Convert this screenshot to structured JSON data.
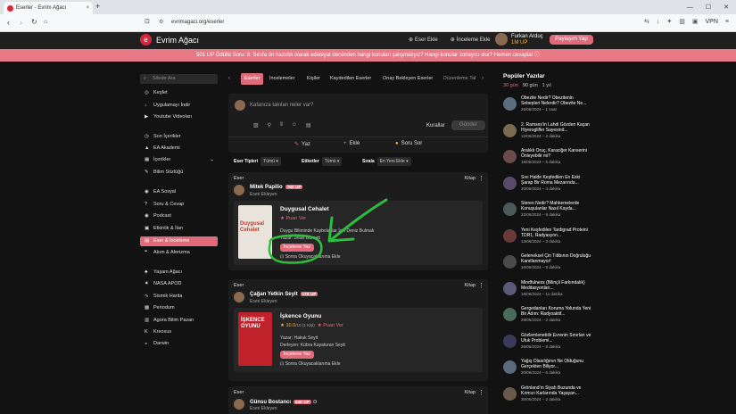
{
  "browser": {
    "tab_title": "Eserler - Evrim Ağacı",
    "tab_close": "×",
    "new_tab": "+",
    "url": "evrimagaci.org/eserler",
    "vpn_label": "VPN",
    "window_controls": [
      "—",
      "☐",
      "✕"
    ]
  },
  "site": {
    "name": "Evrim Ağacı",
    "add_work": "Eser Ekle",
    "add_review": "İnceleme Ekle",
    "user_name": "Furkan Arduç",
    "user_points": "1M UP",
    "share_button": "Paylaşım Yap"
  },
  "banner": {
    "text": "501 UP Ödüllü Soru: 9. Sınıfa ön hazırlık olarak edebiyat dersinden hangi konuları çalışmalıyız? Hangi konular zorlayıcı olur? Hemen cevapla!"
  },
  "sidebar": {
    "search_placeholder": "Sitede Ara",
    "items": [
      {
        "label": "Keşfet",
        "icon": "compass-icon"
      },
      {
        "label": "Uygulamayı İndir",
        "icon": "download-icon"
      },
      {
        "label": "Youtube Videoları",
        "icon": "youtube-icon"
      },
      {
        "label": "Son İçerikler",
        "icon": "clock-icon"
      },
      {
        "label": "EA Akademi",
        "icon": "academy-icon"
      },
      {
        "label": "İçerikler",
        "icon": "content-icon"
      },
      {
        "label": "Bilim Sözlüğü",
        "icon": "dictionary-icon"
      },
      {
        "label": "EA Sosyal",
        "icon": "social-icon"
      },
      {
        "label": "Soru & Cevap",
        "icon": "question-icon"
      },
      {
        "label": "Podcast",
        "icon": "podcast-icon"
      },
      {
        "label": "Etkinlik & İlan",
        "icon": "event-icon"
      },
      {
        "label": "Eser & İnceleme",
        "icon": "book-icon"
      },
      {
        "label": "Akım & Aforizma",
        "icon": "quote-icon"
      },
      {
        "label": "Yaşam Ağacı",
        "icon": "tree-icon"
      },
      {
        "label": "NASA APOD",
        "icon": "nasa-icon"
      },
      {
        "label": "Sismik Harita",
        "icon": "seismic-icon"
      },
      {
        "label": "Periodum",
        "icon": "periodic-icon"
      },
      {
        "label": "Agora Bilim Pazarı",
        "icon": "market-icon"
      },
      {
        "label": "Kreosus",
        "icon": "kreosus-icon"
      },
      {
        "label": "Darwin",
        "icon": "darwin-icon"
      }
    ]
  },
  "tabs": [
    "Eserler",
    "İncelemeler",
    "Kişiler",
    "Kaydedilen Eserler",
    "Onay Bekleyen Eserler",
    "Düzenleme Tal"
  ],
  "composer": {
    "placeholder": "Kafanıza takılan neler var?",
    "rules": "Kurallar",
    "send": "Gönder",
    "write": "Yaz",
    "add": "Ekle",
    "ask": "Soru Sor"
  },
  "filters": {
    "type_label": "Eser Tipleri",
    "type_value": "Tümü",
    "tag_label": "Etiketler",
    "tag_value": "Tümü",
    "sort_label": "Sırala",
    "sort_value": "En Yeni Ekle"
  },
  "posts": [
    {
      "type": "Eser",
      "category": "Kitap",
      "author": "Mitek Papilio",
      "badge": "76K UP",
      "sub": "Eseri Ekleyen",
      "title": "Duygusal Cehalet",
      "rating": "Puan Ver",
      "line1": "Duygu Biliminde Kaybolanlar İçin Deniz Bulmak",
      "line2": "Yazar: Dean Burnett",
      "review": "İnceleme Yaz",
      "later": "Sonra Okuyacaklarıma Ekle",
      "cover_text": "Duygusal Cehalet"
    },
    {
      "type": "Eser",
      "category": "Kitap",
      "author": "Çağan Yetkin Seyit",
      "badge": "17K UP",
      "sub": "Eseri Ekleyen",
      "title": "İşkence Oyunu",
      "score": "10.0",
      "score_suffix": "/10 (1 Kişi)",
      "rating": "Puan Ver",
      "line1": "Yazar: Hakuk Seyit",
      "line2": "Derleyen: Kübra Kayaturan Seyit",
      "review": "İnceleme Yaz",
      "later": "Sonra Okuyacaklarıma Ekle",
      "cover_text": "İŞKENCE OYUNU"
    },
    {
      "type": "Eser",
      "category": "Kitap",
      "author": "Günsu Bostancı",
      "badge": "64K UP",
      "sub": "Eseri Ekleyen"
    }
  ],
  "popular": {
    "title": "Popüler Yazılar",
    "ranges": [
      "30 gün",
      "90 gün",
      "1 yıl"
    ],
    "items": [
      {
        "title": "Obezite Nedir? Obezitenin Sebepleri Nelerdir? Obezite Ne...",
        "date": "25/06/2024 – 1 saat"
      },
      {
        "title": "2. Ramses'in Lahdi Gözden Kaçan Hiyeroglifler Sayesind...",
        "date": "12/06/2024 – 2 dakika"
      },
      {
        "title": "Aralıklı Oruç, Karaciğer Kanserini Önleyebilir mi?",
        "date": "18/06/2024 – 5 dakika"
      },
      {
        "title": "Sıvı Halde Keşfedilen En Eski Şarap Bir Roma Mezarında...",
        "date": "20/06/2024 – 4 dakika"
      },
      {
        "title": "Stereo Nedir? Mahkemelerde Konuşulanlar Nasıl Kayda...",
        "date": "22/06/2024 – 9 dakika"
      },
      {
        "title": "Yeni Keşfedilen Tardigrad Proteini TDR1, Radyasyon...",
        "date": "13/06/2024 – 3 dakika"
      },
      {
        "title": "Geleneksel Çin Tıbbının Doğruluğu Kanıtlanmayor!",
        "date": "16/06/2024 – 9 dakika"
      },
      {
        "title": "Mindfulness (Bilinçli Farkındalık) Meditasyonları...",
        "date": "18/06/2024 – 11 dakika"
      },
      {
        "title": "Gergedanları Koruma Yolunda Yeni Bir Adım: Radyoaktif...",
        "date": "29/06/2024 – 2 dakika"
      },
      {
        "title": "Gözlemlenebilir Evrenin Sınırları ve Ufuk Problemi...",
        "date": "26/06/2024 – 8 dakika"
      },
      {
        "title": "Yağış Olasılığının Ne Olduğunu Gerçekten Biliyor...",
        "date": "20/06/2024 – 6 dakika"
      },
      {
        "title": "Grönland'ın Siyah Buzunda ve Kırmızı Karlarında Yaşayan...",
        "date": "30/06/2024 – 2 dakika"
      }
    ]
  },
  "colors": {
    "accent": "#e06a7a",
    "banner": "#e77886",
    "annotation": "#2ebd3f"
  }
}
